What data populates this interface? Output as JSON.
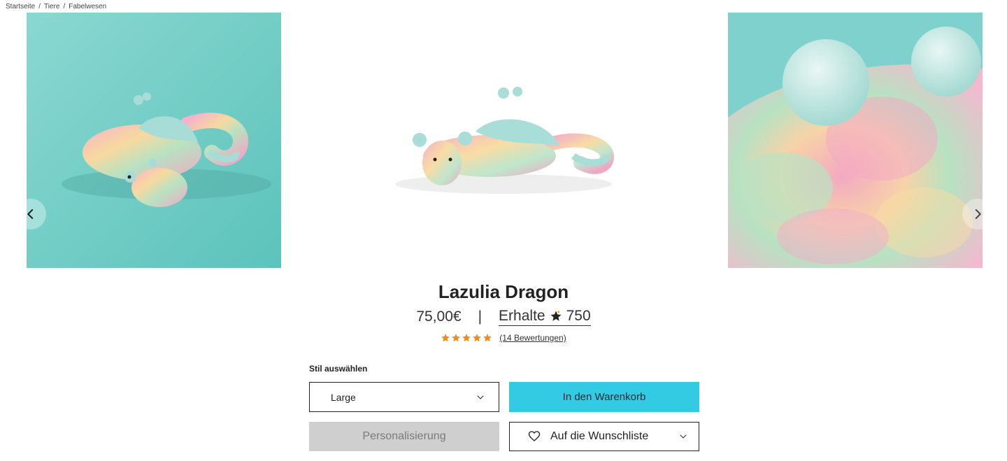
{
  "breadcrumb": {
    "items": [
      "Startseite",
      "Tiere",
      "Fabelwesen"
    ],
    "separator": "/"
  },
  "gallery": {
    "images": [
      {
        "name": "dragon-on-teal",
        "bg": "#7fd3cc"
      },
      {
        "name": "dragon-on-white",
        "bg": "#ffffff"
      },
      {
        "name": "fur-closeup",
        "bg": "#7fd1cd"
      }
    ],
    "prev_icon": "chevron-left-icon",
    "next_icon": "chevron-right-icon"
  },
  "product": {
    "title": "Lazulia Dragon",
    "price": "75,00€",
    "divider": "|",
    "reward_label": "Erhalte",
    "reward_points": "750",
    "rating": 5,
    "reviews_link": "(14 Bewertungen)",
    "star_color": "#f08a1a"
  },
  "options": {
    "style_label": "Stil auswählen",
    "selected_style": "Large"
  },
  "actions": {
    "add_to_cart": "In den Warenkorb",
    "personalize": "Personalisierung",
    "wishlist": "Auf die Wunschliste"
  },
  "colors": {
    "cart_button": "#33cbe3",
    "disabled_button": "#cfcfcf"
  }
}
